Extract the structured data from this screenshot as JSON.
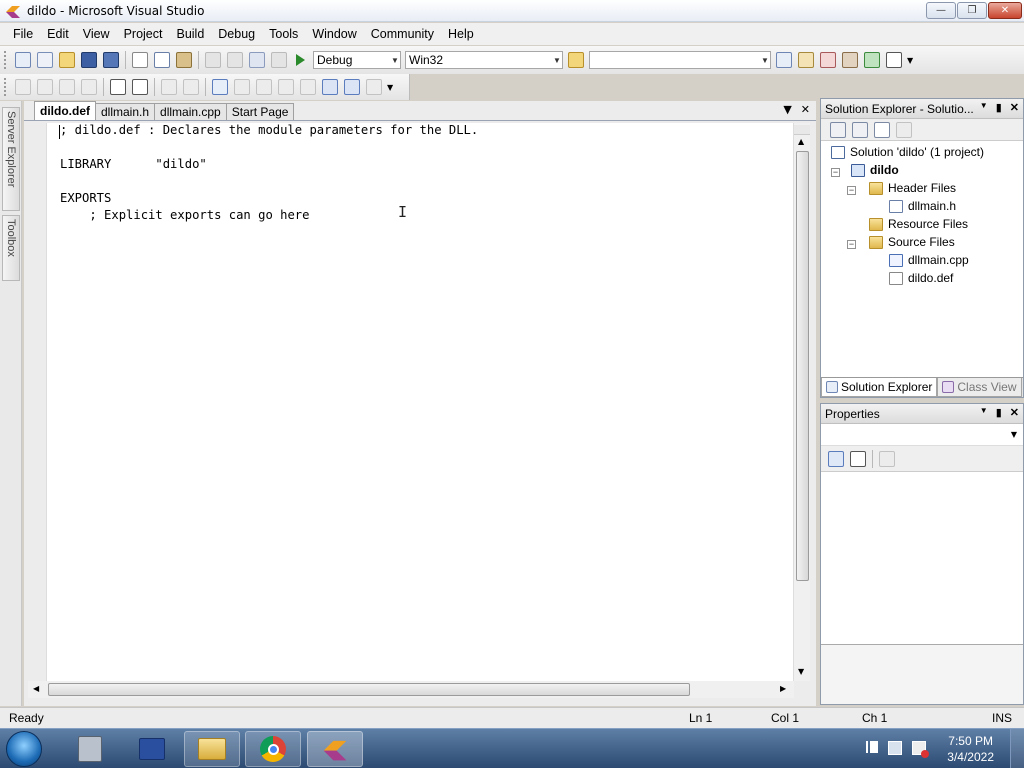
{
  "window": {
    "title": "dildo - Microsoft Visual Studio"
  },
  "menu": [
    "File",
    "Edit",
    "View",
    "Project",
    "Build",
    "Debug",
    "Tools",
    "Window",
    "Community",
    "Help"
  ],
  "toolbar": {
    "config": "Debug",
    "platform": "Win32",
    "find_box": ""
  },
  "left_dock": {
    "server_explorer": "Server Explorer",
    "toolbox": "Toolbox"
  },
  "editor": {
    "tabs": [
      "dildo.def",
      "dllmain.h",
      "dllmain.cpp",
      "Start Page"
    ],
    "active_tab": "dildo.def",
    "lines": [
      "; dildo.def : Declares the module parameters for the DLL.",
      "LIBRARY      \"dildo\"",
      "EXPORTS",
      "    ; Explicit exports can go here"
    ]
  },
  "solution_explorer": {
    "title": "Solution Explorer - Solutio...",
    "solution": "Solution 'dildo' (1 project)",
    "project": "dildo",
    "header_files": "Header Files",
    "header_file_1": "dllmain.h",
    "resource_files": "Resource Files",
    "source_files": "Source Files",
    "source_file_1": "dllmain.cpp",
    "source_file_2": "dildo.def",
    "tab_solution": "Solution Explorer",
    "tab_class": "Class View"
  },
  "properties": {
    "title": "Properties"
  },
  "status": {
    "ready": "Ready",
    "ln": "Ln 1",
    "col": "Col 1",
    "ch": "Ch 1",
    "ins": "INS"
  },
  "clock": {
    "time": "7:50 PM",
    "date": "3/4/2022"
  },
  "colors": {
    "taskbar": "#3b5a85",
    "editor_bg": "#ffffff",
    "folder": "#e0b84e"
  }
}
